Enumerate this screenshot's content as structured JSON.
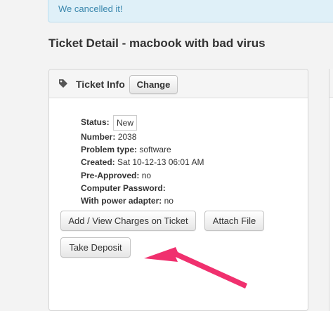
{
  "alert": {
    "message": "We cancelled it!"
  },
  "page": {
    "title": "Ticket Detail - macbook with bad virus"
  },
  "panel": {
    "icon": "tag-icon",
    "title": "Ticket Info",
    "change_label": "Change"
  },
  "ticket": {
    "status_label": "Status:",
    "status_value": "New",
    "number_label": "Number:",
    "number_value": "2038",
    "problem_label": "Problem type:",
    "problem_value": "software",
    "created_label": "Created:",
    "created_value": "Sat 10-12-13 06:01 AM",
    "preapproved_label": "Pre-Approved:",
    "preapproved_value": "no",
    "password_label": "Computer Password:",
    "password_value": "",
    "adapter_label": "With power adapter:",
    "adapter_value": "no"
  },
  "actions": {
    "charges_label": "Add / View Charges on Ticket",
    "attach_label": "Attach File",
    "deposit_label": "Take Deposit"
  },
  "annotation": {
    "arrow_color": "#f0306e"
  }
}
